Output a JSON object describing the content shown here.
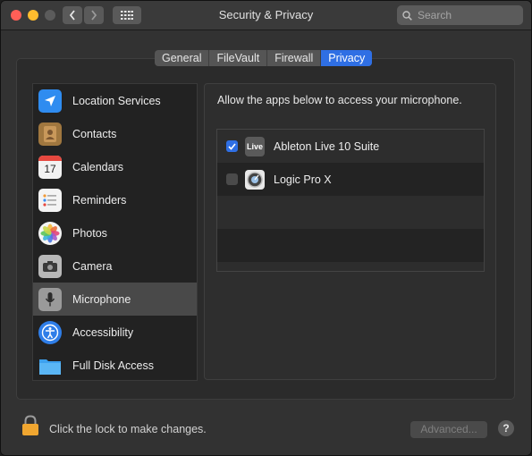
{
  "window": {
    "title": "Security & Privacy"
  },
  "search": {
    "placeholder": "Search"
  },
  "tabs": [
    {
      "label": "General",
      "active": false
    },
    {
      "label": "FileVault",
      "active": false
    },
    {
      "label": "Firewall",
      "active": false
    },
    {
      "label": "Privacy",
      "active": true
    }
  ],
  "categories": [
    {
      "label": "Location Services",
      "icon": "location-arrow-icon"
    },
    {
      "label": "Contacts",
      "icon": "contacts-book-icon"
    },
    {
      "label": "Calendars",
      "icon": "calendar-icon",
      "icon_text": "17"
    },
    {
      "label": "Reminders",
      "icon": "reminders-list-icon"
    },
    {
      "label": "Photos",
      "icon": "photos-flower-icon"
    },
    {
      "label": "Camera",
      "icon": "camera-icon"
    },
    {
      "label": "Microphone",
      "icon": "microphone-icon",
      "selected": true
    },
    {
      "label": "Accessibility",
      "icon": "accessibility-icon"
    },
    {
      "label": "Full Disk Access",
      "icon": "folder-icon"
    }
  ],
  "detail": {
    "description": "Allow the apps below to access your microphone.",
    "apps": [
      {
        "name": "Ableton Live 10 Suite",
        "checked": true,
        "icon": "ableton-live-icon",
        "icon_text": "Live"
      },
      {
        "name": "Logic Pro X",
        "checked": false,
        "icon": "logic-pro-icon"
      }
    ]
  },
  "footer": {
    "lock_text": "Click the lock to make changes.",
    "advanced_label": "Advanced...",
    "help_label": "?"
  },
  "colors": {
    "accent": "#2f6fe4",
    "close": "#ff5f57",
    "minimize": "#febc2e"
  }
}
